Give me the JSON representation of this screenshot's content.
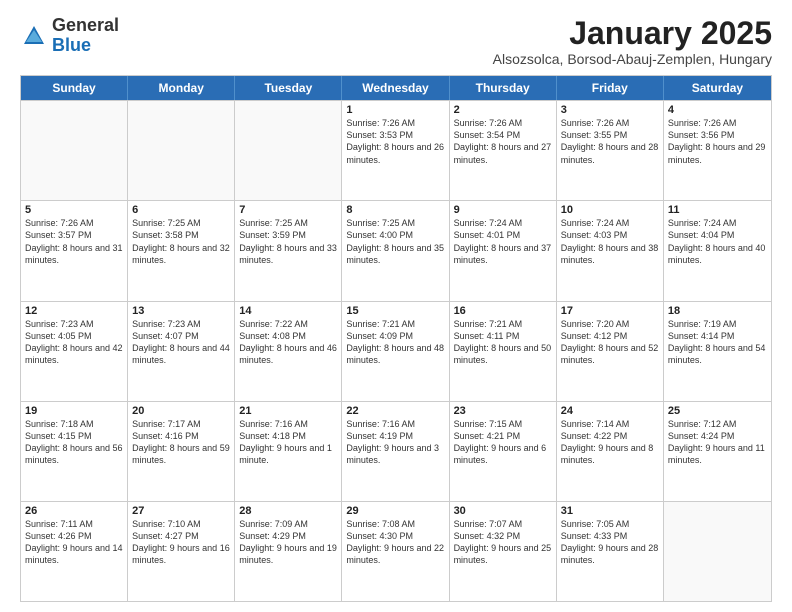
{
  "header": {
    "logo_general": "General",
    "logo_blue": "Blue",
    "title": "January 2025",
    "subtitle": "Alsozsolca, Borsod-Abauj-Zemplen, Hungary"
  },
  "days_of_week": [
    "Sunday",
    "Monday",
    "Tuesday",
    "Wednesday",
    "Thursday",
    "Friday",
    "Saturday"
  ],
  "weeks": [
    [
      {
        "day": "",
        "empty": true
      },
      {
        "day": "",
        "empty": true
      },
      {
        "day": "",
        "empty": true
      },
      {
        "day": "1",
        "sunrise": "7:26 AM",
        "sunset": "3:53 PM",
        "daylight": "8 hours and 26 minutes."
      },
      {
        "day": "2",
        "sunrise": "7:26 AM",
        "sunset": "3:54 PM",
        "daylight": "8 hours and 27 minutes."
      },
      {
        "day": "3",
        "sunrise": "7:26 AM",
        "sunset": "3:55 PM",
        "daylight": "8 hours and 28 minutes."
      },
      {
        "day": "4",
        "sunrise": "7:26 AM",
        "sunset": "3:56 PM",
        "daylight": "8 hours and 29 minutes."
      }
    ],
    [
      {
        "day": "5",
        "sunrise": "7:26 AM",
        "sunset": "3:57 PM",
        "daylight": "8 hours and 31 minutes."
      },
      {
        "day": "6",
        "sunrise": "7:25 AM",
        "sunset": "3:58 PM",
        "daylight": "8 hours and 32 minutes."
      },
      {
        "day": "7",
        "sunrise": "7:25 AM",
        "sunset": "3:59 PM",
        "daylight": "8 hours and 33 minutes."
      },
      {
        "day": "8",
        "sunrise": "7:25 AM",
        "sunset": "4:00 PM",
        "daylight": "8 hours and 35 minutes."
      },
      {
        "day": "9",
        "sunrise": "7:24 AM",
        "sunset": "4:01 PM",
        "daylight": "8 hours and 37 minutes."
      },
      {
        "day": "10",
        "sunrise": "7:24 AM",
        "sunset": "4:03 PM",
        "daylight": "8 hours and 38 minutes."
      },
      {
        "day": "11",
        "sunrise": "7:24 AM",
        "sunset": "4:04 PM",
        "daylight": "8 hours and 40 minutes."
      }
    ],
    [
      {
        "day": "12",
        "sunrise": "7:23 AM",
        "sunset": "4:05 PM",
        "daylight": "8 hours and 42 minutes."
      },
      {
        "day": "13",
        "sunrise": "7:23 AM",
        "sunset": "4:07 PM",
        "daylight": "8 hours and 44 minutes."
      },
      {
        "day": "14",
        "sunrise": "7:22 AM",
        "sunset": "4:08 PM",
        "daylight": "8 hours and 46 minutes."
      },
      {
        "day": "15",
        "sunrise": "7:21 AM",
        "sunset": "4:09 PM",
        "daylight": "8 hours and 48 minutes."
      },
      {
        "day": "16",
        "sunrise": "7:21 AM",
        "sunset": "4:11 PM",
        "daylight": "8 hours and 50 minutes."
      },
      {
        "day": "17",
        "sunrise": "7:20 AM",
        "sunset": "4:12 PM",
        "daylight": "8 hours and 52 minutes."
      },
      {
        "day": "18",
        "sunrise": "7:19 AM",
        "sunset": "4:14 PM",
        "daylight": "8 hours and 54 minutes."
      }
    ],
    [
      {
        "day": "19",
        "sunrise": "7:18 AM",
        "sunset": "4:15 PM",
        "daylight": "8 hours and 56 minutes."
      },
      {
        "day": "20",
        "sunrise": "7:17 AM",
        "sunset": "4:16 PM",
        "daylight": "8 hours and 59 minutes."
      },
      {
        "day": "21",
        "sunrise": "7:16 AM",
        "sunset": "4:18 PM",
        "daylight": "9 hours and 1 minute."
      },
      {
        "day": "22",
        "sunrise": "7:16 AM",
        "sunset": "4:19 PM",
        "daylight": "9 hours and 3 minutes."
      },
      {
        "day": "23",
        "sunrise": "7:15 AM",
        "sunset": "4:21 PM",
        "daylight": "9 hours and 6 minutes."
      },
      {
        "day": "24",
        "sunrise": "7:14 AM",
        "sunset": "4:22 PM",
        "daylight": "9 hours and 8 minutes."
      },
      {
        "day": "25",
        "sunrise": "7:12 AM",
        "sunset": "4:24 PM",
        "daylight": "9 hours and 11 minutes."
      }
    ],
    [
      {
        "day": "26",
        "sunrise": "7:11 AM",
        "sunset": "4:26 PM",
        "daylight": "9 hours and 14 minutes."
      },
      {
        "day": "27",
        "sunrise": "7:10 AM",
        "sunset": "4:27 PM",
        "daylight": "9 hours and 16 minutes."
      },
      {
        "day": "28",
        "sunrise": "7:09 AM",
        "sunset": "4:29 PM",
        "daylight": "9 hours and 19 minutes."
      },
      {
        "day": "29",
        "sunrise": "7:08 AM",
        "sunset": "4:30 PM",
        "daylight": "9 hours and 22 minutes."
      },
      {
        "day": "30",
        "sunrise": "7:07 AM",
        "sunset": "4:32 PM",
        "daylight": "9 hours and 25 minutes."
      },
      {
        "day": "31",
        "sunrise": "7:05 AM",
        "sunset": "4:33 PM",
        "daylight": "9 hours and 28 minutes."
      },
      {
        "day": "",
        "empty": true
      }
    ]
  ]
}
